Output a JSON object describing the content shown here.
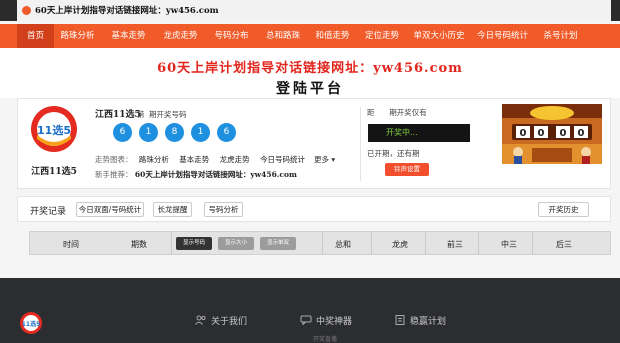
{
  "topbar": {
    "text": "60天上岸计划指导对话链接网址：yw456.com"
  },
  "nav": {
    "items": [
      "首页",
      "路珠分析",
      "基本走势",
      "龙虎走势",
      "号码分布",
      "总和路珠",
      "和值走势",
      "定位走势",
      "单双大小历史",
      "今日号码统计",
      "杀号计划"
    ],
    "active_index": 0
  },
  "hero": {
    "slogan": "60天上岸计划指导对话链接网址：yw456.com",
    "platform": "登陆平台"
  },
  "lottery": {
    "logo_name": "江西11选5",
    "logo_mark": "11选5",
    "title": "江西11选5",
    "issue_prefix": "第",
    "issue_suffix": "期开奖号码",
    "balls": [
      "6",
      "1",
      "8",
      "1",
      "6"
    ],
    "links_label": "走势图表：",
    "links": [
      "路珠分析",
      "基本走势",
      "龙虎走势",
      "今日号码统计"
    ],
    "more": "更多",
    "guide_label": "新手推荐：",
    "guide_value": "60天上岸计划指导对话链接网址：yw456.com",
    "countdown_prefix": "距",
    "countdown_suffix": "期开奖仅有",
    "status": "开奖中...",
    "stopped_text": "已开期，还有期",
    "bell_button": "铃声设置",
    "game_image_digits": [
      "0",
      "0",
      "0",
      "0"
    ]
  },
  "records": {
    "label": "开奖记录",
    "buttons": [
      "今日双面/号码统计",
      "长龙提醒",
      "号码分析"
    ],
    "history_button": "开奖历史"
  },
  "table": {
    "headers": [
      "时间",
      "期数",
      "总和",
      "龙虎",
      "前三",
      "中三",
      "后三"
    ],
    "display_buttons": [
      "显示号码",
      "显示大小",
      "显示单双"
    ],
    "colors": {
      "active_btn": "#333333",
      "inactive_btn": "#9c9c9c"
    }
  },
  "footer": {
    "items": [
      "关于我们",
      "中奖神器",
      "稳赢计划"
    ],
    "subtitle": "开奖直播",
    "logo_mark": "11选5"
  },
  "colors": {
    "brand": "#f15a29",
    "ball": "#1f8fe0",
    "slogan": "#e2251d"
  }
}
